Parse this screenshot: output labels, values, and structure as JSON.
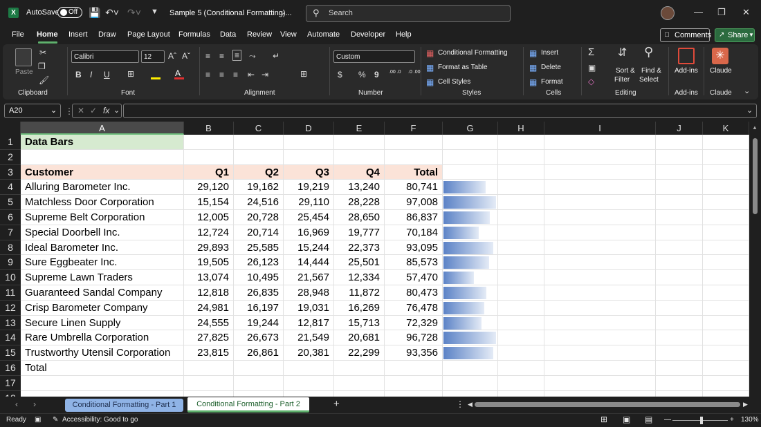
{
  "titlebar": {
    "autosave_label": "AutoSave",
    "autosave_state": "Off",
    "filename": "Sample 5 (Conditional Formatting)...",
    "search_placeholder": "Search"
  },
  "menu": {
    "items": [
      "File",
      "Home",
      "Insert",
      "Draw",
      "Page Layout",
      "Formulas",
      "Data",
      "Review",
      "View",
      "Automate",
      "Developer",
      "Help"
    ],
    "active": "Home",
    "comments_label": "Comments",
    "share_label": "Share"
  },
  "ribbon": {
    "clipboard": {
      "paste": "Paste",
      "label": "Clipboard"
    },
    "font": {
      "name": "Calibri",
      "size": "12",
      "label": "Font"
    },
    "alignment": {
      "label": "Alignment"
    },
    "number": {
      "format": "Custom",
      "label": "Number",
      "dollar": "$",
      "percent": "%",
      "comma": "9",
      "inc": ".00 .0",
      "dec": ".0 .00"
    },
    "styles": {
      "conditional": "Conditional Formatting",
      "format_table": "Format as Table",
      "cell_styles": "Cell Styles",
      "label": "Styles"
    },
    "cells": {
      "insert": "Insert",
      "delete": "Delete",
      "format": "Format",
      "label": "Cells"
    },
    "editing": {
      "sort": "Sort &",
      "filter": "Filter",
      "find": "Find &",
      "select": "Select",
      "label": "Editing"
    },
    "addins": {
      "name": "Add-ins",
      "label": "Add-ins"
    },
    "claude": {
      "name": "Claude",
      "label": "Claude"
    }
  },
  "formula_bar": {
    "name_box": "A20",
    "content": ""
  },
  "columns": [
    "A",
    "B",
    "C",
    "D",
    "E",
    "F",
    "G",
    "H",
    "I",
    "J",
    "K"
  ],
  "selected_column": "A",
  "selected_row": "20",
  "rows": [
    "1",
    "2",
    "3",
    "4",
    "5",
    "6",
    "7",
    "8",
    "9",
    "10",
    "11",
    "12",
    "13",
    "14",
    "15",
    "16",
    "17",
    "18"
  ],
  "sheet": {
    "title": "Data Bars",
    "headers": {
      "customer": "Customer",
      "q1": "Q1",
      "q2": "Q2",
      "q3": "Q3",
      "q4": "Q4",
      "total": "Total"
    },
    "records": [
      {
        "customer": "Alluring Barometer Inc.",
        "q1": "29,120",
        "q2": "19,162",
        "q3": "19,219",
        "q4": "13,240",
        "total": "80,741",
        "bar": 0.78
      },
      {
        "customer": "Matchless Door Corporation",
        "q1": "15,154",
        "q2": "24,516",
        "q3": "29,110",
        "q4": "28,228",
        "total": "97,008",
        "bar": 0.97
      },
      {
        "customer": "Supreme Belt Corporation",
        "q1": "12,005",
        "q2": "20,728",
        "q3": "25,454",
        "q4": "28,650",
        "total": "86,837",
        "bar": 0.86
      },
      {
        "customer": "Special Doorbell Inc.",
        "q1": "12,724",
        "q2": "20,714",
        "q3": "16,969",
        "q4": "19,777",
        "total": "70,184",
        "bar": 0.66
      },
      {
        "customer": "Ideal Barometer Inc.",
        "q1": "29,893",
        "q2": "25,585",
        "q3": "15,244",
        "q4": "22,373",
        "total": "93,095",
        "bar": 0.92
      },
      {
        "customer": "Sure Eggbeater Inc.",
        "q1": "19,505",
        "q2": "26,123",
        "q3": "14,444",
        "q4": "25,501",
        "total": "85,573",
        "bar": 0.85
      },
      {
        "customer": "Supreme Lawn Traders",
        "q1": "13,074",
        "q2": "10,495",
        "q3": "21,567",
        "q4": "12,334",
        "total": "57,470",
        "bar": 0.56
      },
      {
        "customer": "Guaranteed Sandal Company",
        "q1": "12,818",
        "q2": "26,835",
        "q3": "28,948",
        "q4": "11,872",
        "total": "80,473",
        "bar": 0.79
      },
      {
        "customer": "Crisp Barometer Company",
        "q1": "24,981",
        "q2": "16,197",
        "q3": "19,031",
        "q4": "16,269",
        "total": "76,478",
        "bar": 0.75
      },
      {
        "customer": "Secure Linen Supply",
        "q1": "24,555",
        "q2": "19,244",
        "q3": "12,817",
        "q4": "15,713",
        "total": "72,329",
        "bar": 0.7
      },
      {
        "customer": "Rare Umbrella Corporation",
        "q1": "27,825",
        "q2": "26,673",
        "q3": "21,549",
        "q4": "20,681",
        "total": "96,728",
        "bar": 0.97
      },
      {
        "customer": "Trustworthy Utensil Corporation",
        "q1": "23,815",
        "q2": "26,861",
        "q3": "20,381",
        "q4": "22,299",
        "total": "93,356",
        "bar": 0.92
      }
    ],
    "total_label": "Total"
  },
  "tabs": [
    "Conditional Formatting - Part 1",
    "Conditional Formatting - Part 2"
  ],
  "active_tab": "Conditional Formatting - Part 2",
  "status": {
    "ready": "Ready",
    "accessibility": "Accessibility: Good to go",
    "zoom": "130%"
  },
  "colors": {
    "title_fill": "#d6ead0",
    "header_fill": "#fbe3d8",
    "bar": "#5b82c6",
    "accent": "#5fb16d"
  }
}
